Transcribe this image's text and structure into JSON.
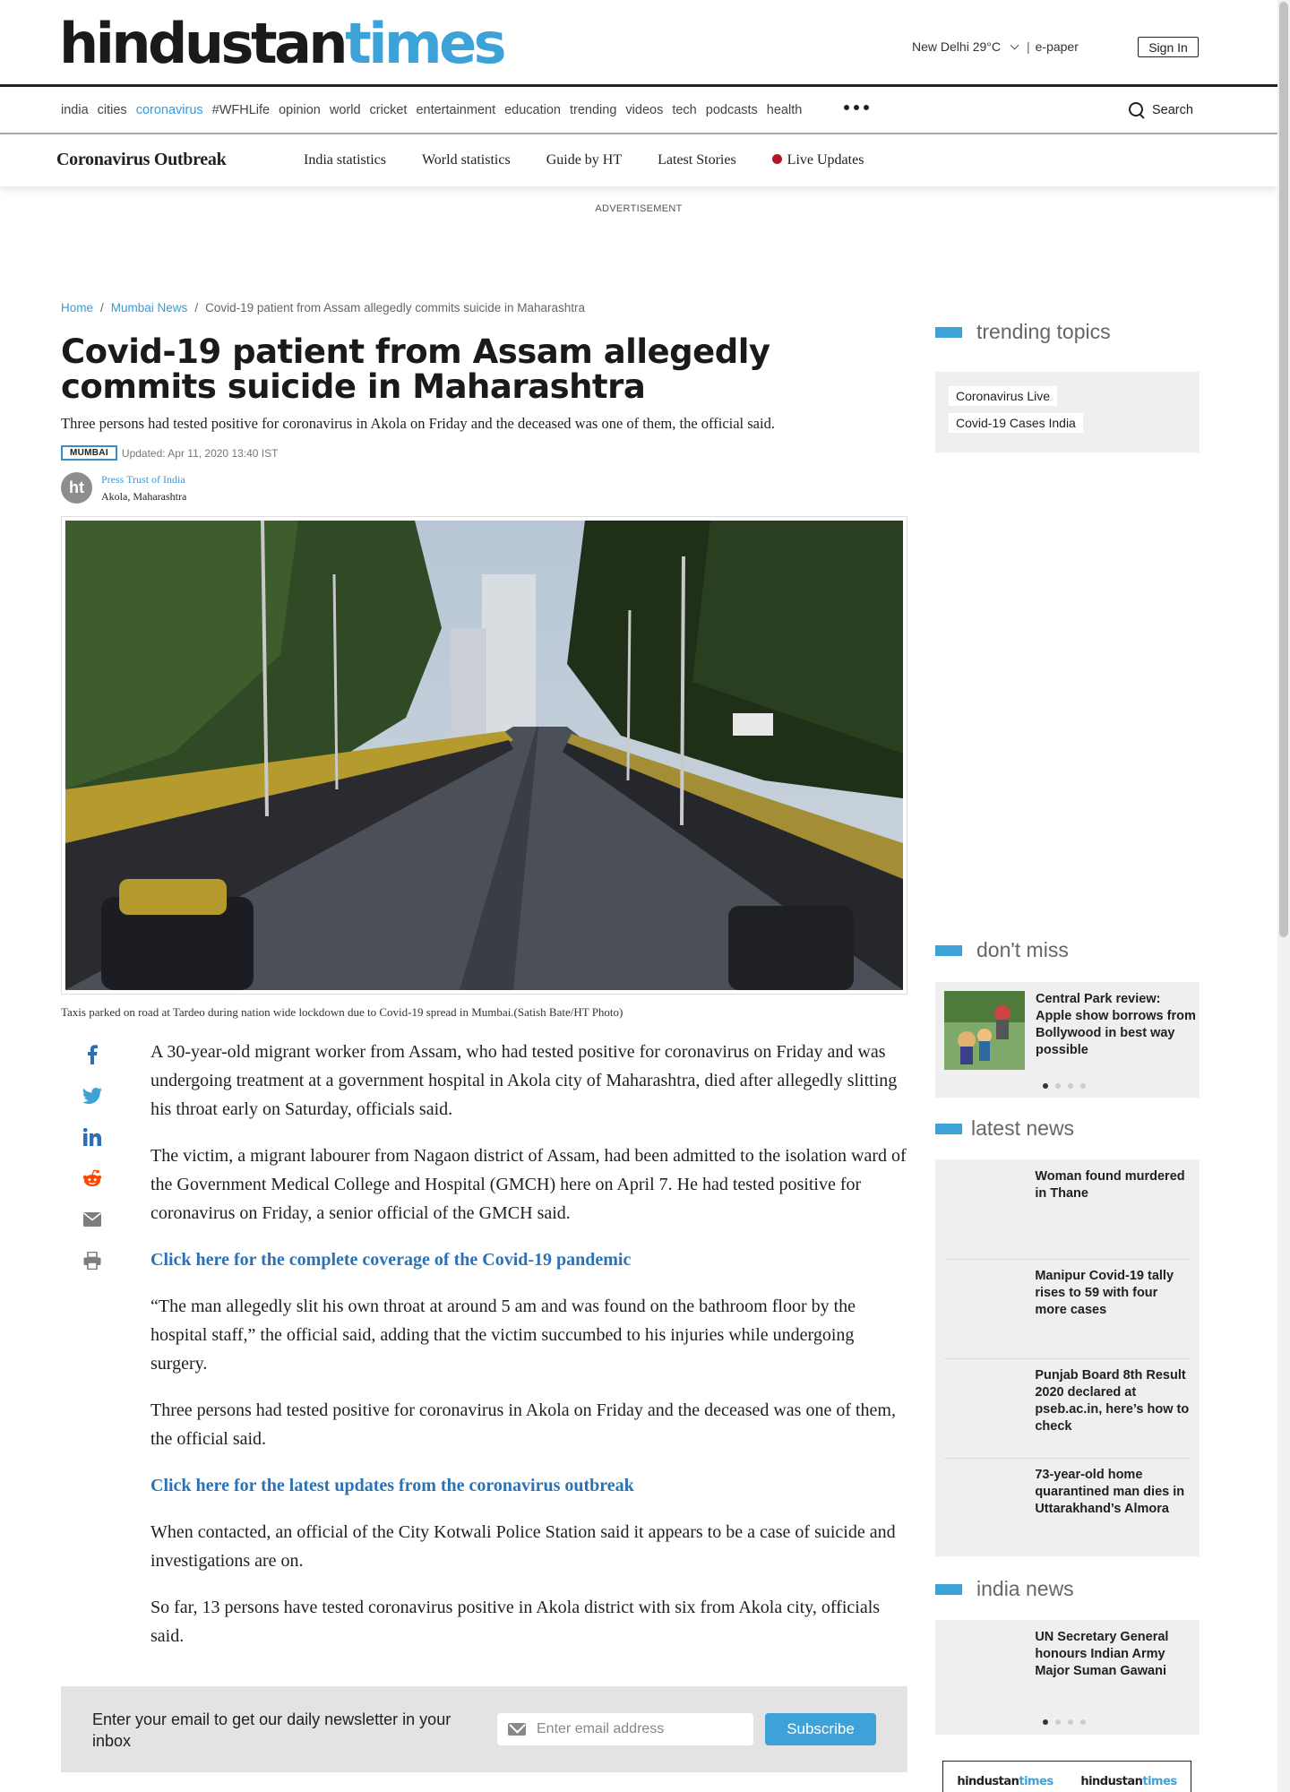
{
  "header": {
    "logo_part1": "hindustan",
    "logo_part2": "times",
    "weather": "New Delhi 29°C",
    "separator": "|",
    "epaper": "e-paper",
    "signin": "Sign In"
  },
  "nav": {
    "items": [
      "india",
      "cities",
      "coronavirus",
      "#WFHLife",
      "opinion",
      "world",
      "cricket",
      "entertainment",
      "education",
      "trending",
      "videos",
      "tech",
      "podcasts",
      "health"
    ],
    "active": "coronavirus",
    "search_label": "Search"
  },
  "subnav": {
    "title": "Coronavirus Outbreak",
    "items": [
      "India statistics",
      "World statistics",
      "Guide by HT",
      "Latest Stories",
      "Live Updates"
    ]
  },
  "ad_label": "ADVERTISEMENT",
  "breadcrumb": {
    "home": "Home",
    "sep": "/",
    "section": "Mumbai News",
    "current": "Covid-19 patient from Assam allegedly commits suicide in Maharashtra"
  },
  "article": {
    "headline": "Covid-19 patient from Assam allegedly commits suicide in Maharashtra",
    "subhead": "Three persons had tested positive for coronavirus in Akola on Friday and the deceased was one of them, the official said.",
    "tag": "MUMBAI",
    "updated": "Updated: Apr 11, 2020 13:40 IST",
    "author_initials": "ht",
    "author": "Press Trust of India",
    "location": "Akola, Maharashtra",
    "caption": "Taxis parked on road at Tardeo during nation wide lockdown due to Covid-19 spread in Mumbai.(Satish Bate/HT Photo)",
    "p1": "A 30-year-old migrant worker from Assam, who had tested positive for coronavirus on Friday and was undergoing treatment at a government hospital in Akola city of Maharashtra, died after allegedly slitting his throat early on Saturday, officials said.",
    "p2": "The victim, a migrant labourer from Nagaon district of Assam, had been admitted to the isolation ward of the Government Medical College and Hospital (GMCH) here on April 7. He had tested positive for coronavirus on Friday, a senior official of the GMCH said.",
    "link1": "Click here for the complete coverage of the Covid-19 pandemic",
    "p3": "“The man allegedly slit his own throat at around 5 am and was found on the bathroom floor by the hospital staff,” the official said, adding that the victim succumbed to his injuries while undergoing surgery.",
    "p4": "Three persons had tested positive for coronavirus in Akola on Friday and the deceased was one of them, the official said.",
    "link2": "Click here for the latest updates from the coronavirus outbreak",
    "p5": "When contacted, an official of the City Kotwali Police Station said it appears to be a case of suicide and investigations are on.",
    "p6": "So far, 13 persons have tested coronavirus positive in Akola district with six from Akola city, officials said."
  },
  "newsletter": {
    "text": "Enter your email to get our daily newsletter in your inbox",
    "placeholder": "Enter email address",
    "button": "Subscribe"
  },
  "sidebar": {
    "trending_title": "trending topics",
    "trending": [
      "Coronavirus Live",
      "Covid-19 Cases India"
    ],
    "dont_miss_title": "don't miss",
    "dont_miss_item": "Central Park review: Apple show borrows from Bollywood in best way possible",
    "latest_title": "latest news",
    "latest": [
      "Woman found murdered in Thane",
      "Manipur Covid-19 tally rises to 59 with four more cases",
      "Punjab Board 8th Result 2020 declared at pseb.ac.in, here’s how to check",
      "73-year-old home quarantined man dies in Uttarakhand’s Almora"
    ],
    "india_title": "india news",
    "india_item": "UN Secretary General honours Indian Army Major Suman Gawani"
  },
  "colors": {
    "accent": "#3da2d8",
    "link": "#2a72b5",
    "live": "#b5152b"
  }
}
